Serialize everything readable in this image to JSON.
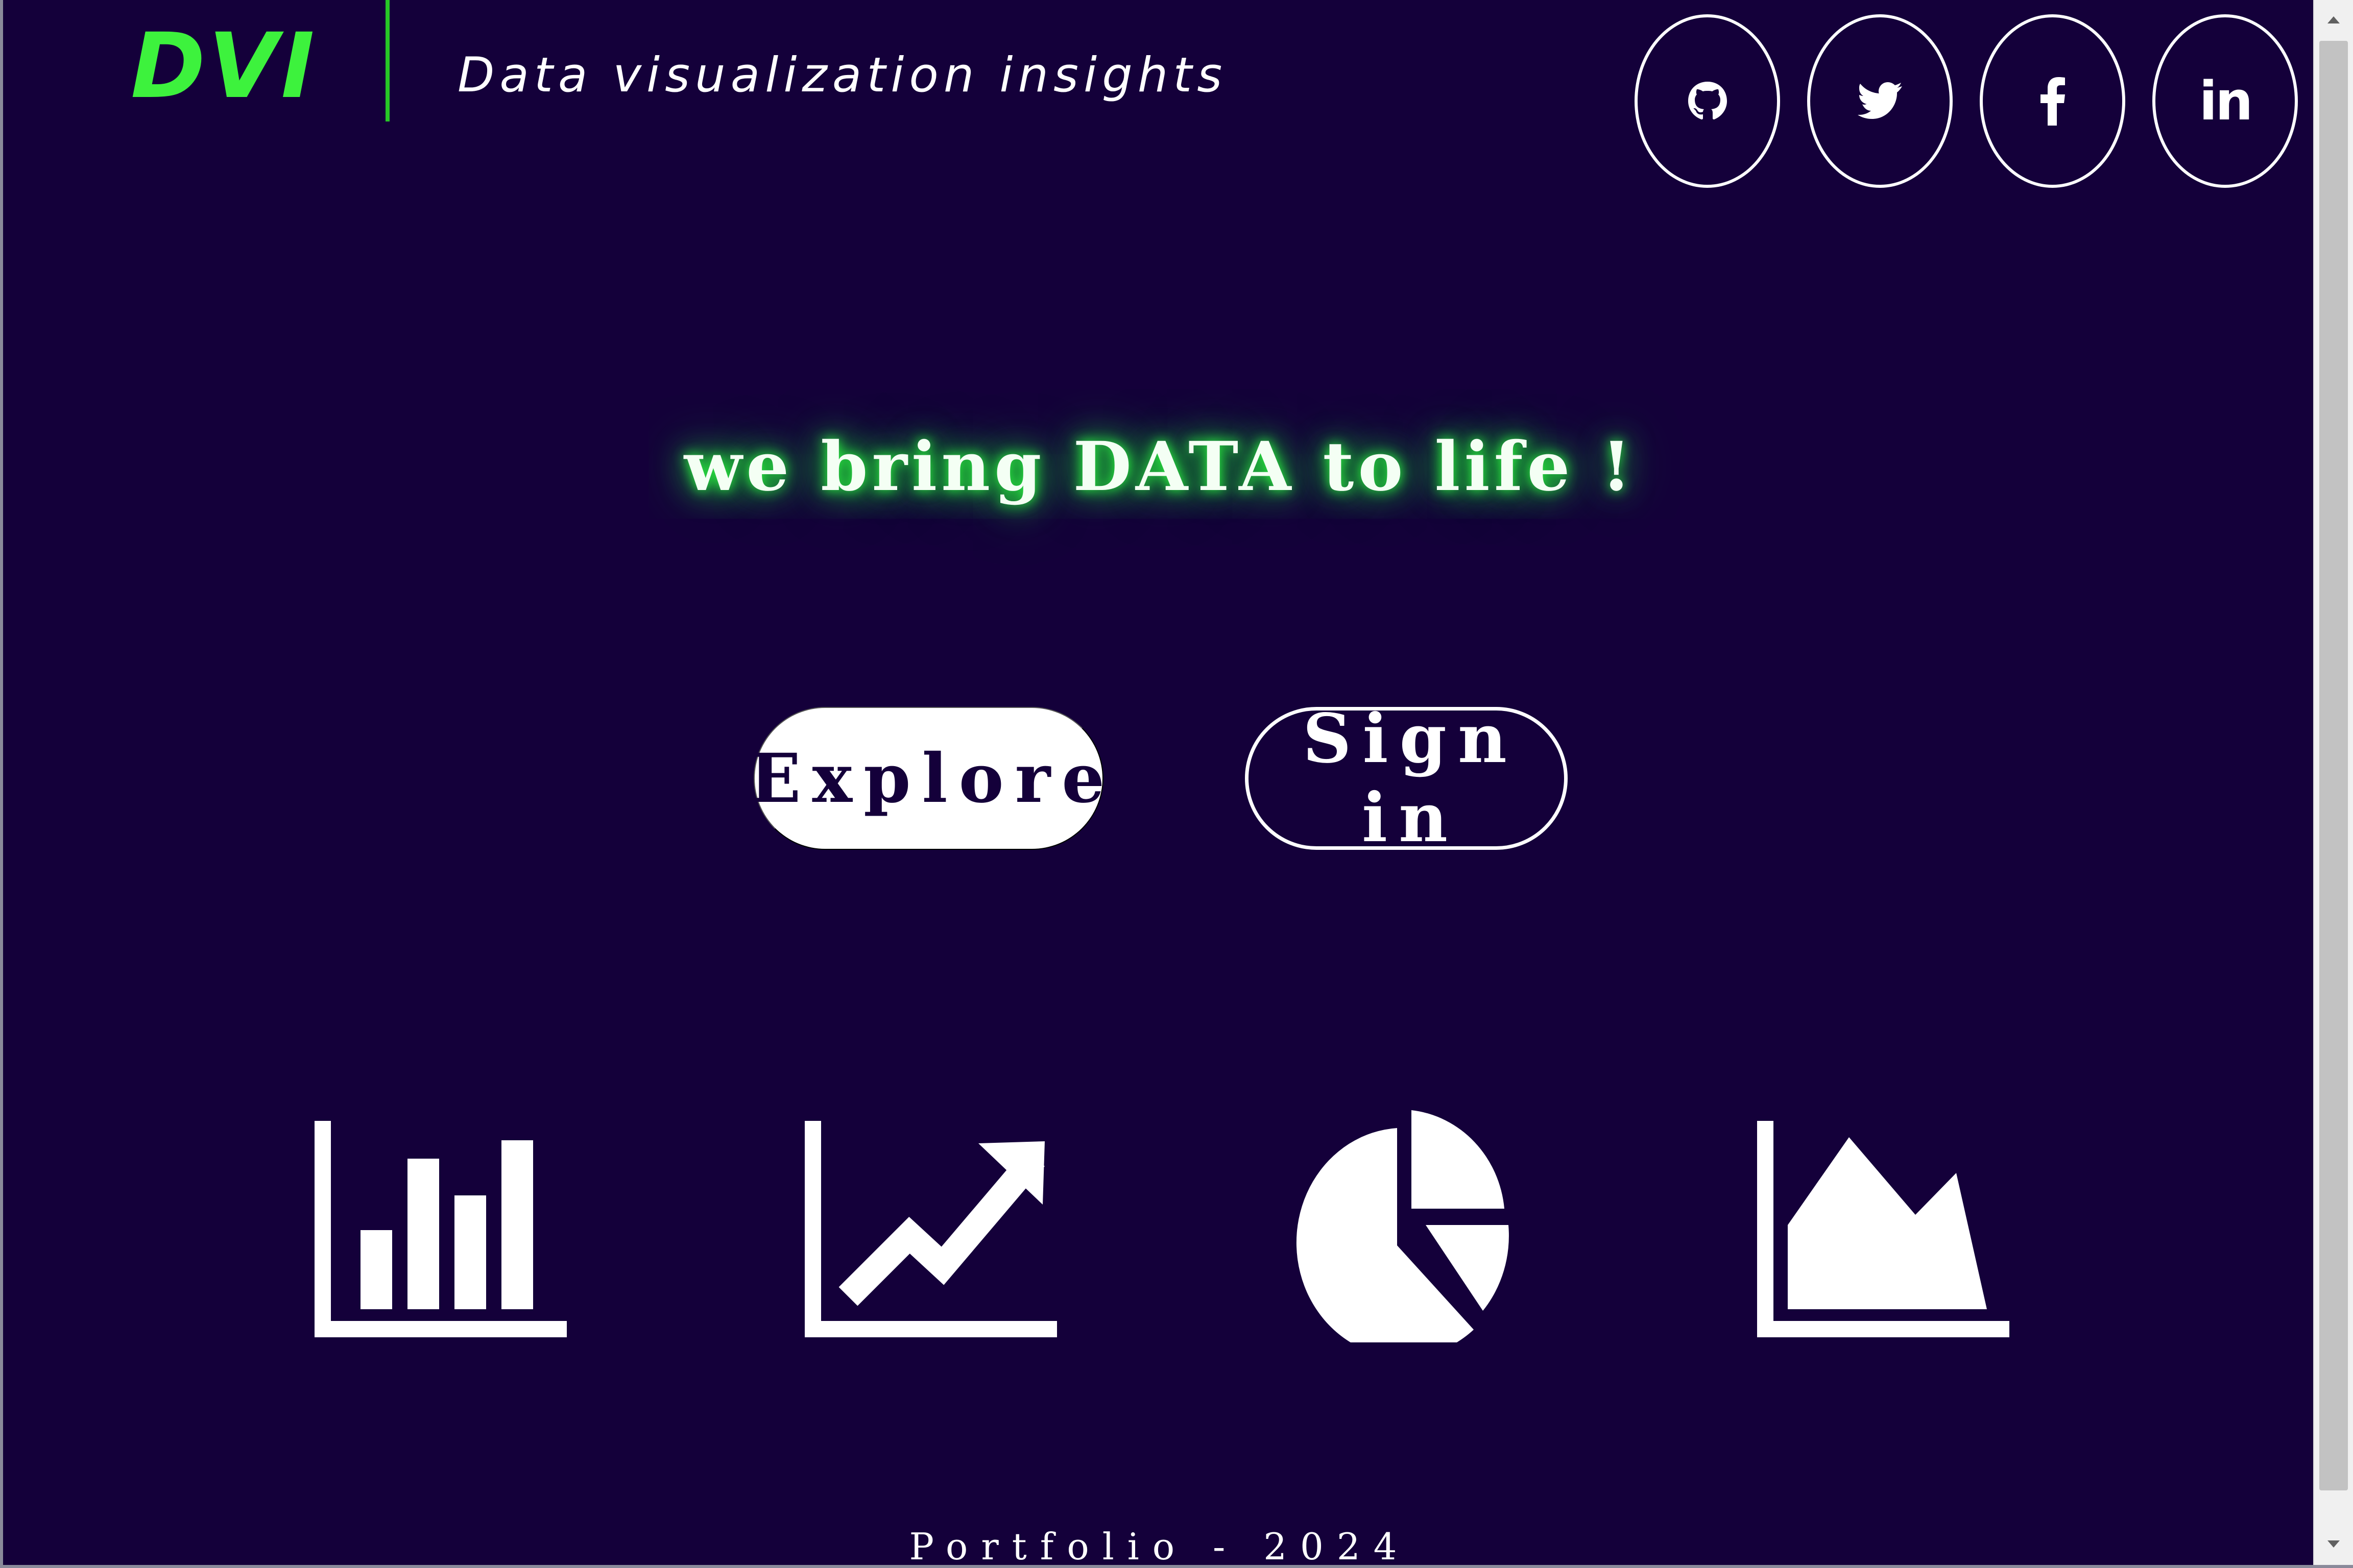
{
  "header": {
    "logo": "DVI",
    "tagline": "Data visualization insights"
  },
  "social": [
    {
      "name": "github",
      "icon": "github-icon"
    },
    {
      "name": "twitter",
      "icon": "twitter-icon"
    },
    {
      "name": "facebook",
      "icon": "facebook-icon"
    },
    {
      "name": "linkedin",
      "icon": "linkedin-icon",
      "label": "in"
    }
  ],
  "hero": {
    "headline": "we bring DATA to life !"
  },
  "buttons": {
    "explore_label": "Explore",
    "signin_label": "Sign in"
  },
  "chart_icons": [
    "bar-chart-icon",
    "line-chart-icon",
    "pie-chart-icon",
    "area-chart-icon"
  ],
  "footer": {
    "text": "Portfolio - 2024"
  },
  "colors": {
    "background": "#14003a",
    "accent_green": "#3df23d",
    "text": "#ffffff"
  }
}
